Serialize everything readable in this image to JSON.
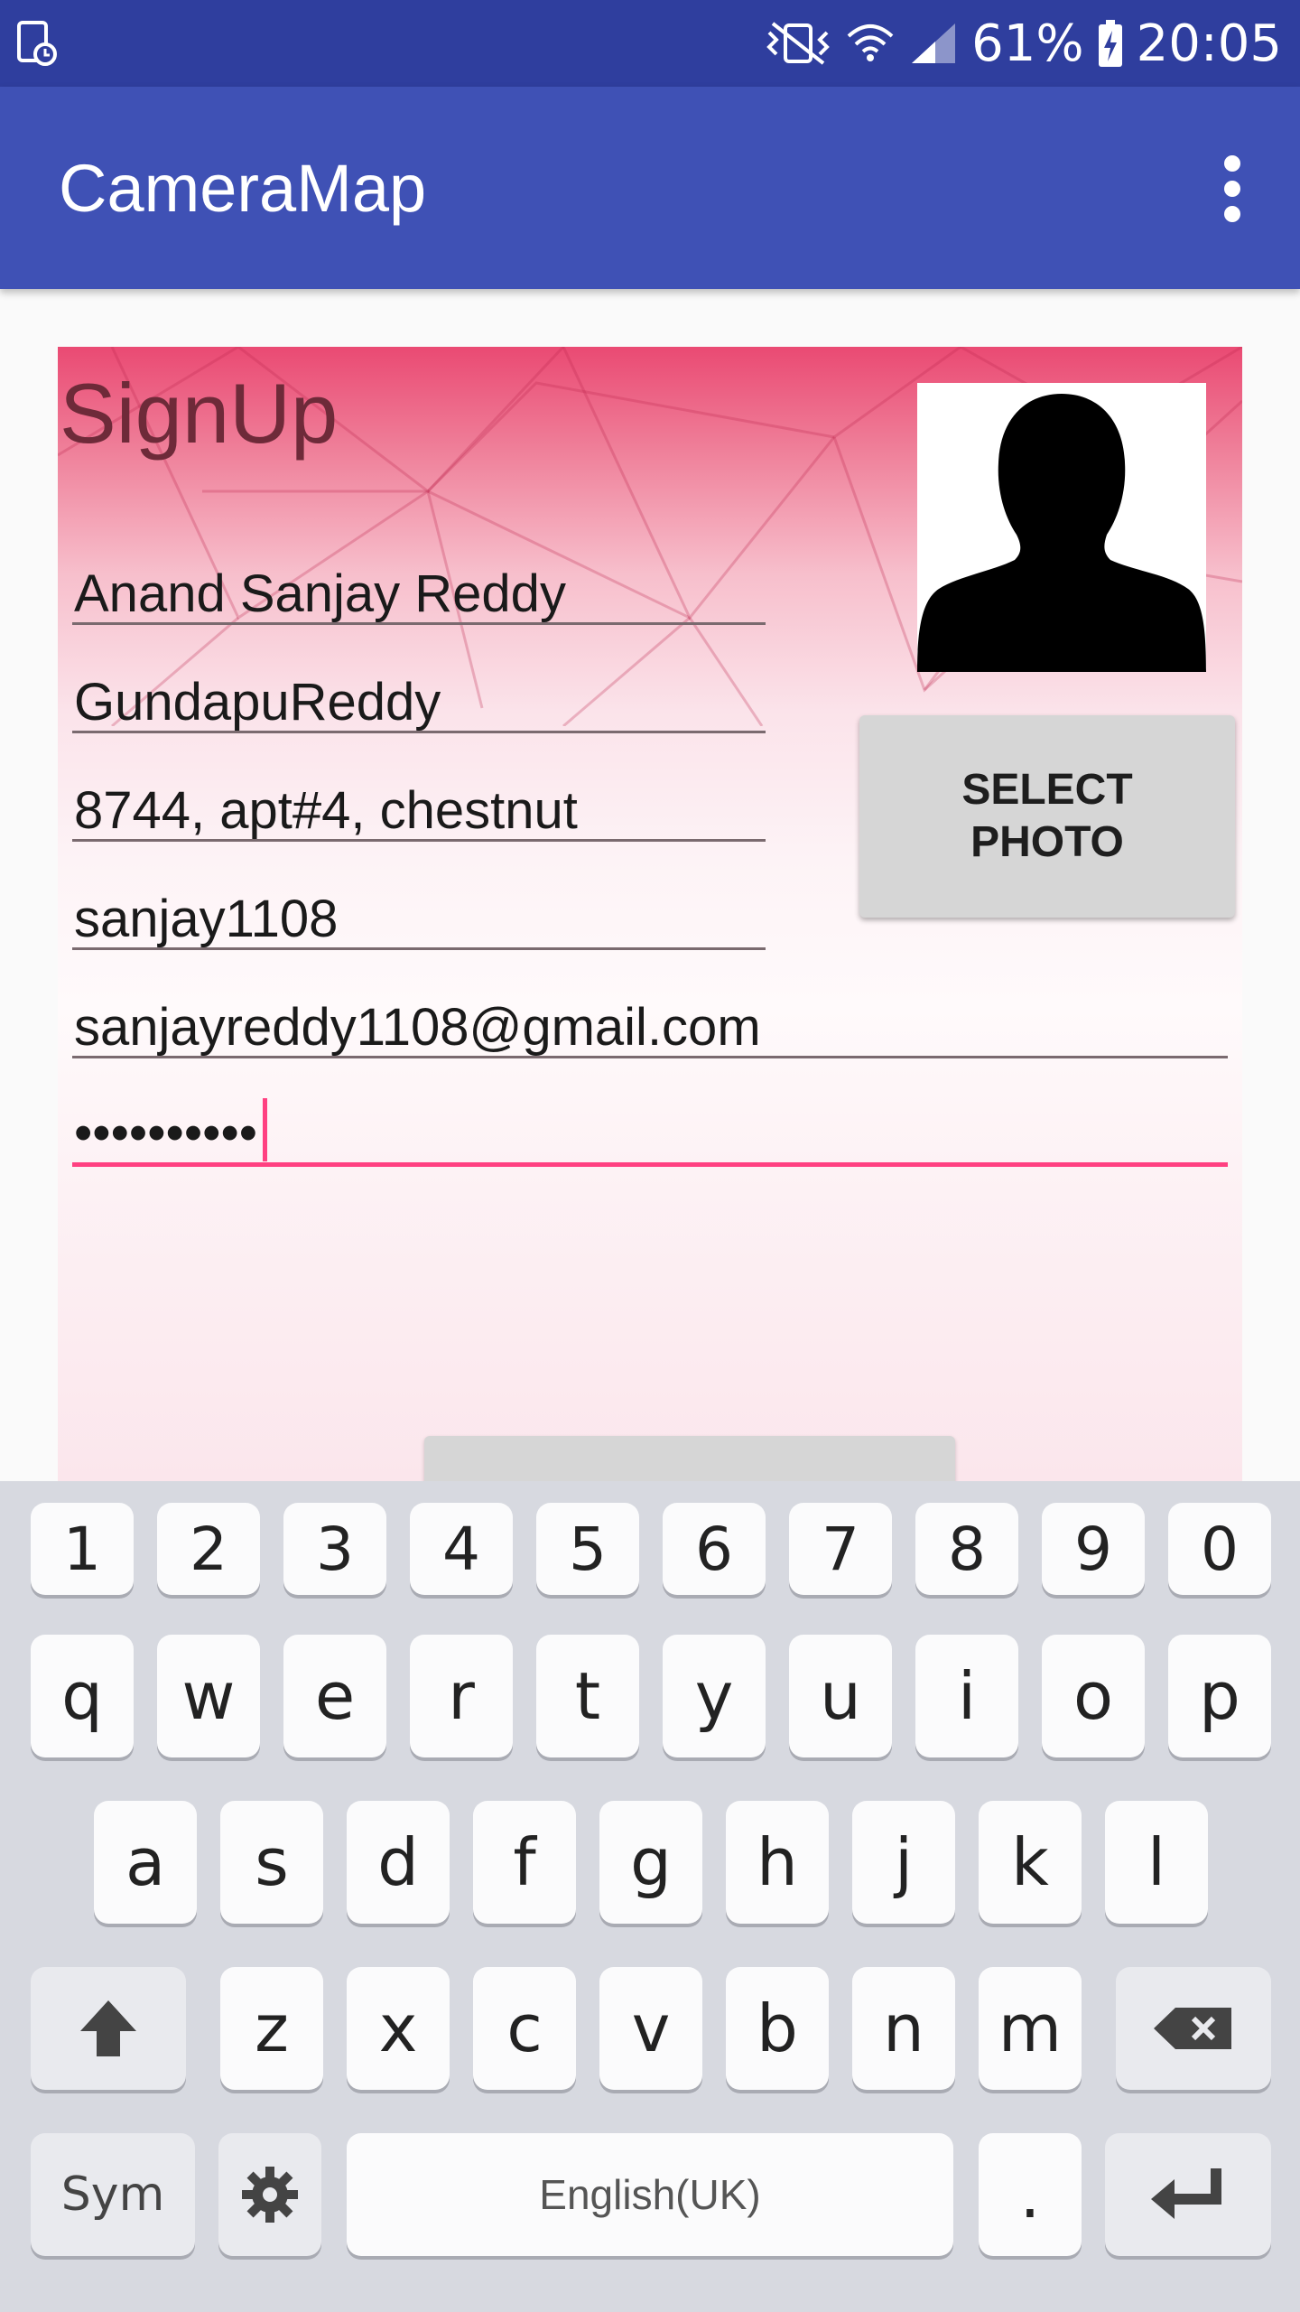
{
  "status_bar": {
    "battery": "61%",
    "time": "20:05",
    "icons": [
      "screenshot-icon",
      "mute-vibrate-icon",
      "wifi-icon",
      "signal-icon",
      "battery-charging-icon"
    ]
  },
  "app_bar": {
    "title": "CameraMap",
    "menu_icon": "overflow-menu-icon"
  },
  "form": {
    "title": "SignUp",
    "fields": [
      {
        "name": "first-name",
        "value": "Anand Sanjay Reddy"
      },
      {
        "name": "last-name",
        "value": "GundapuReddy"
      },
      {
        "name": "address",
        "value": "8744, apt#4, chestnut"
      },
      {
        "name": "username",
        "value": "sanjay1108"
      },
      {
        "name": "email",
        "value": "sanjayreddy1108@gmail.com"
      },
      {
        "name": "password",
        "value": "••••••••••"
      }
    ],
    "select_photo_label": "SELECT\nPHOTO"
  },
  "keyboard": {
    "number_row": [
      "1",
      "2",
      "3",
      "4",
      "5",
      "6",
      "7",
      "8",
      "9",
      "0"
    ],
    "row1": [
      "q",
      "w",
      "e",
      "r",
      "t",
      "y",
      "u",
      "i",
      "o",
      "p"
    ],
    "row2": [
      "a",
      "s",
      "d",
      "f",
      "g",
      "h",
      "j",
      "k",
      "l"
    ],
    "row3": [
      "z",
      "x",
      "c",
      "v",
      "b",
      "n",
      "m"
    ],
    "sym_label": "Sym",
    "space_label": "English(UK)",
    "period_label": ".",
    "colors": {
      "background": "#d7d9e0",
      "key": "#fbfbfc",
      "accent": "#ff4081"
    }
  },
  "colors": {
    "status_bar": "#2f3e9e",
    "app_bar": "#3f51b5",
    "accent": "#ff4081"
  }
}
